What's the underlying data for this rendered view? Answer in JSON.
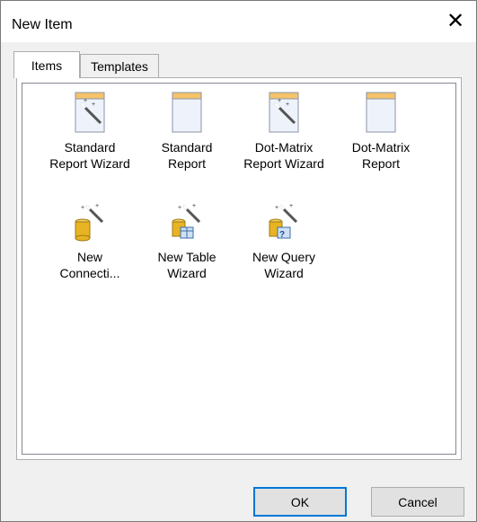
{
  "window": {
    "title": "New Item",
    "close_glyph": "✕"
  },
  "tabs": [
    {
      "label": "Items",
      "active": true
    },
    {
      "label": "Templates",
      "active": false
    }
  ],
  "items": [
    {
      "label": "Standard\nReport Wizard",
      "icon": "report-wizard-icon"
    },
    {
      "label": "Standard\nReport",
      "icon": "report-icon"
    },
    {
      "label": "Dot-Matrix\nReport Wizard",
      "icon": "report-wizard-icon"
    },
    {
      "label": "Dot-Matrix\nReport",
      "icon": "report-icon"
    },
    {
      "label": "New\nConnecti...",
      "icon": "connection-wizard-icon"
    },
    {
      "label": "New Table\nWizard",
      "icon": "table-wizard-icon"
    },
    {
      "label": "New Query\nWizard",
      "icon": "query-wizard-icon"
    }
  ],
  "buttons": {
    "ok": "OK",
    "cancel": "Cancel"
  },
  "colors": {
    "accent": "#0078d7",
    "report_header": "#f5c36a",
    "database": "#e8b423"
  }
}
